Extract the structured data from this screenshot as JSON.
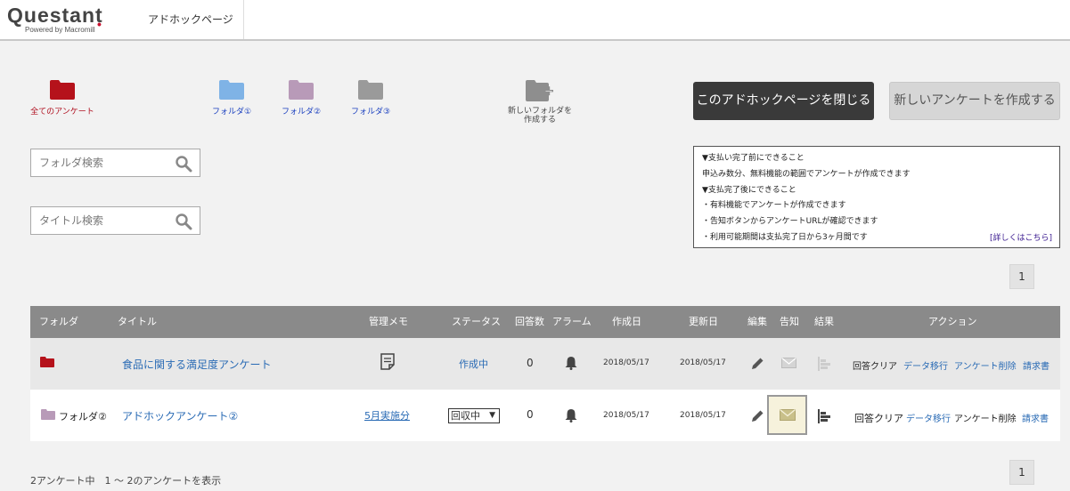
{
  "header": {
    "logo_main": "Questant",
    "logo_sub": "Powered by Macromill",
    "tab_label": "アドホックページ"
  },
  "folders": [
    {
      "label": "全てのアンケート",
      "color": "#b5121b"
    },
    {
      "label": "フォルダ①",
      "color": "#7fb3e6"
    },
    {
      "label": "フォルダ②",
      "color": "#b89ab8"
    },
    {
      "label": "フォルダ③",
      "color": "#9a9a9a"
    }
  ],
  "new_folder": {
    "line1": "新しいフォルダを",
    "line2": "作成する",
    "icon": "folder-plus-icon"
  },
  "buttons": {
    "close_label": "このアドホックページを閉じる",
    "new_label": "新しいアンケートを作成する"
  },
  "info": {
    "lines": [
      "▼支払い完了前にできること",
      "申込み数分、無料機能の範囲でアンケートが作成できます",
      "▼支払完了後にできること",
      "・有料機能でアンケートが作成できます",
      "・告知ボタンからアンケートURLが確認できます",
      "・利用可能期間は支払完了日から3ヶ月間です"
    ],
    "link": "[詳しくはこちら]"
  },
  "search": {
    "folder_placeholder": "フォルダ検索",
    "title_placeholder": "タイトル検索"
  },
  "pager": {
    "top": "1",
    "bottom": "1"
  },
  "table": {
    "headers": {
      "folder": "フォルダ",
      "title": "タイトル",
      "memo": "管理メモ",
      "status": "ステータス",
      "count": "回答数",
      "alarm": "アラーム",
      "created": "作成日",
      "updated": "更新日",
      "edit": "編集",
      "notice": "告知",
      "result": "結果",
      "action": "アクション"
    },
    "rows": [
      {
        "folder_label": "",
        "folder_color": "#b5121b",
        "title": "食品に関する満足度アンケート",
        "memo": "",
        "status": "作成中",
        "count": "0",
        "created": "2018/05/17",
        "updated": "2018/05/17",
        "actions": {
          "clear": "回答クリア",
          "migrate": "データ移行",
          "delete": "アンケート削除",
          "invoice": "請求書"
        }
      },
      {
        "folder_label": "フォルダ②",
        "folder_color": "#b89ab8",
        "title": "アドホックアンケート②",
        "memo": "5月実施分",
        "status": "回収中",
        "count": "0",
        "created": "2018/05/17",
        "updated": "2018/05/17",
        "actions": {
          "clear": "回答クリア",
          "migrate": "データ移行",
          "delete": "アンケート削除",
          "invoice": "請求書"
        }
      }
    ]
  },
  "footer": {
    "summary": "2アンケート中　1 ～ 2のアンケートを表示"
  }
}
